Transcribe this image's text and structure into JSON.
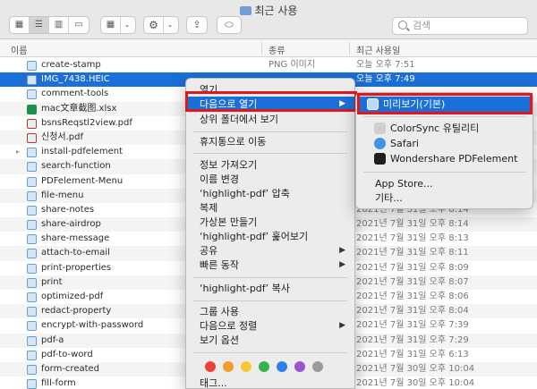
{
  "window": {
    "title": "최근 사용"
  },
  "search": {
    "placeholder": "검색"
  },
  "columns": {
    "name": "이름",
    "kind": "종류",
    "date": "최근 사용일"
  },
  "files": [
    {
      "name": "create-stamp",
      "kind": "PNG 이미지",
      "date": "오늘 오후 7:51",
      "icon": "image-icon"
    },
    {
      "name": "IMG_7438.HEIC",
      "kind": "",
      "date": "오늘 오후 7:49",
      "icon": "image-icon",
      "selected": true
    },
    {
      "name": "comment-tools",
      "kind": "",
      "date": "",
      "icon": "image-icon"
    },
    {
      "name": "mac文章截图.xlsx",
      "kind": "",
      "date": "",
      "icon": "spreadsheet-icon"
    },
    {
      "name": "bsnsReqstl2view.pdf",
      "kind": "",
      "date": "",
      "icon": "pdf-icon"
    },
    {
      "name": "신청서.pdf",
      "kind": "",
      "date": "",
      "icon": "pdf-icon"
    },
    {
      "name": "install-pdfelement",
      "kind": "",
      "date": "",
      "icon": "image-icon"
    },
    {
      "name": "search-function",
      "kind": "",
      "date": "",
      "icon": "image-icon"
    },
    {
      "name": "PDFelement-Menu",
      "kind": "",
      "date": "",
      "icon": "image-icon"
    },
    {
      "name": "file-menu",
      "kind": "",
      "date": "",
      "icon": "image-icon"
    },
    {
      "name": "share-notes",
      "kind": "",
      "date": "2021년 7월 31일 오후 8:14",
      "icon": "image-icon"
    },
    {
      "name": "share-airdrop",
      "kind": "",
      "date": "2021년 7월 31일 오후 8:14",
      "icon": "image-icon"
    },
    {
      "name": "share-message",
      "kind": "",
      "date": "2021년 7월 31일 오후 8:13",
      "icon": "image-icon"
    },
    {
      "name": "attach-to-email",
      "kind": "",
      "date": "2021년 7월 31일 오후 8:11",
      "icon": "image-icon"
    },
    {
      "name": "print-properties",
      "kind": "",
      "date": "2021년 7월 31일 오후 8:09",
      "icon": "image-icon"
    },
    {
      "name": "print",
      "kind": "",
      "date": "2021년 7월 31일 오후 8:07",
      "icon": "image-icon"
    },
    {
      "name": "optimized-pdf",
      "kind": "",
      "date": "2021년 7월 31일 오후 8:06",
      "icon": "image-icon"
    },
    {
      "name": "redact-property",
      "kind": "",
      "date": "2021년 7월 31일 오후 8:04",
      "icon": "image-icon"
    },
    {
      "name": "encrypt-with-password",
      "kind": "",
      "date": "2021년 7월 31일 오후 7:39",
      "icon": "image-icon"
    },
    {
      "name": "pdf-a",
      "kind": "",
      "date": "2021년 7월 31일 오후 7:29",
      "icon": "image-icon"
    },
    {
      "name": "pdf-to-word",
      "kind": "",
      "date": "2021년 7월 31일 오후 6:13",
      "icon": "image-icon"
    },
    {
      "name": "form-created",
      "kind": "",
      "date": "2021년 7월 30일 오후 10:04",
      "icon": "image-icon"
    },
    {
      "name": "fill-form",
      "kind": "",
      "date": "2021년 7월 30일 오후 10:04",
      "icon": "image-icon"
    }
  ],
  "context_menu": {
    "open": "열기",
    "open_with": "다음으로 열기",
    "show_parent": "상위 폴더에서 보기",
    "trash": "휴지통으로 이동",
    "get_info": "정보 가져오기",
    "rename": "이름 변경",
    "compress": "‘highlight-pdf’ 압축",
    "duplicate": "복제",
    "make_alias": "가상본 만들기",
    "quick_look": "‘highlight-pdf’ 훑어보기",
    "share": "공유",
    "quick_actions": "빠른 동작",
    "copy": "‘highlight-pdf’ 복사",
    "use_groups": "그룹 사용",
    "sort_by": "다음으로 정렬",
    "view_options": "보기 옵션",
    "tags": "태그...",
    "tag_colors": [
      "#e9433a",
      "#f39c2a",
      "#f3c935",
      "#36b24a",
      "#2b83e8",
      "#9b55cf",
      "#9a9a9a"
    ]
  },
  "open_with_menu": {
    "default_app": "미리보기(기본)",
    "colorsync": "ColorSync 유틸리티",
    "safari": "Safari",
    "pdfelement": "Wondershare PDFelement",
    "app_store": "App Store...",
    "other": "기타..."
  }
}
